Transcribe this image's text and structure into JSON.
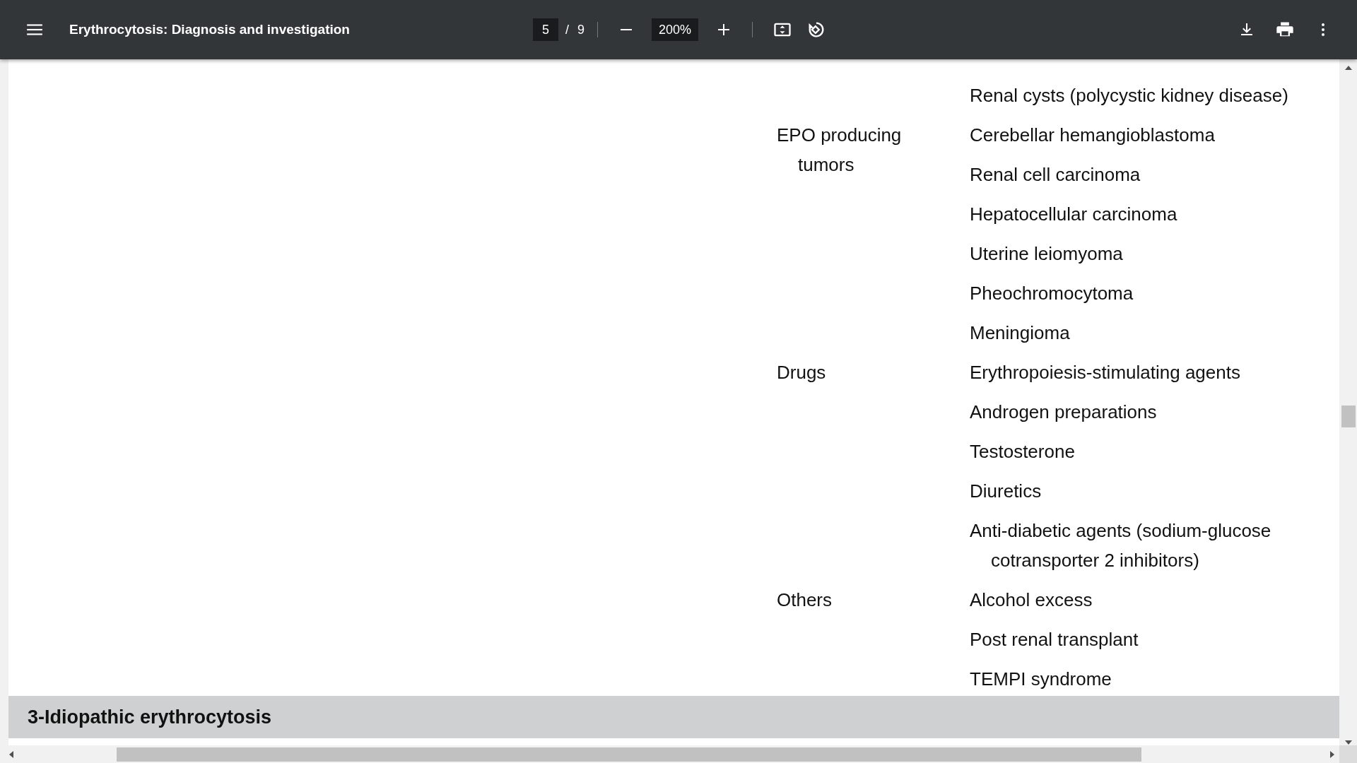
{
  "toolbar": {
    "title": "Erythrocytosis: Diagnosis and investigation",
    "page_number": "5",
    "page_separator": "/",
    "page_count": "9",
    "zoom": "200%"
  },
  "table": {
    "rows": [
      {
        "category": "",
        "items": [
          "Renal cysts (polycystic kidney disease)"
        ]
      },
      {
        "category": "EPO producing tumors",
        "items": [
          "Cerebellar hemangioblastoma",
          "Renal cell carcinoma",
          "Hepatocellular carcinoma",
          "Uterine leiomyoma",
          "Pheochromocytoma",
          "Meningioma"
        ]
      },
      {
        "category": "Drugs",
        "items": [
          "Erythropoiesis-stimulating agents",
          "Androgen preparations",
          "Testosterone",
          "Diuretics",
          "Anti-diabetic agents (sodium-glucose cotransporter 2 inhibitors)"
        ]
      },
      {
        "category": "Others",
        "items": [
          "Alcohol excess",
          "Post renal transplant",
          "TEMPI syndrome"
        ]
      }
    ]
  },
  "section_heading": "3-Idiopathic erythrocytosis"
}
